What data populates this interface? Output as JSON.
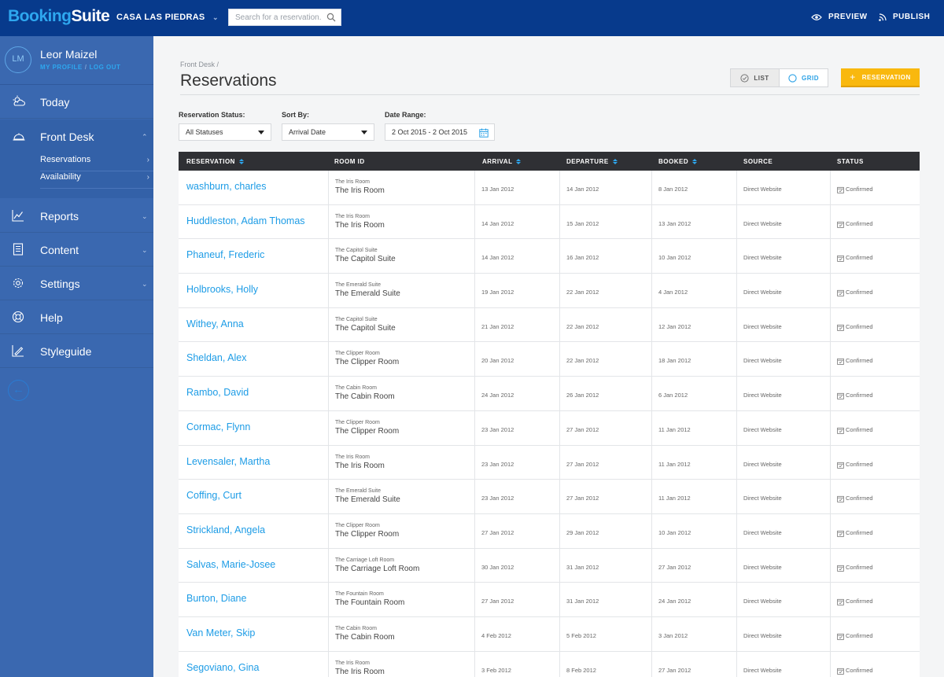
{
  "app": {
    "logo_part1": "Booking",
    "logo_part2": "Suite",
    "hotel": "CASA LAS PIEDRAS"
  },
  "search": {
    "placeholder": "Search for a reservation..."
  },
  "topbar": {
    "preview": "PREVIEW",
    "publish": "PUBLISH"
  },
  "user": {
    "initials": "LM",
    "name": "Leor Maizel",
    "my_profile": "MY PROFILE",
    "separator": "/",
    "log_out": "LOG OUT"
  },
  "nav": {
    "today": "Today",
    "front_desk": "Front Desk",
    "sub": [
      "Reservations",
      "Availability"
    ],
    "reports": "Reports",
    "content": "Content",
    "settings": "Settings",
    "help": "Help",
    "styleguide": "Styleguide"
  },
  "page": {
    "breadcrumb": "Front Desk /",
    "title": "Reservations",
    "view_list": "LIST",
    "view_grid": "GRID",
    "add_button": "RESERVATION"
  },
  "filters": {
    "status_label": "Reservation Status:",
    "status_value": "All Statuses",
    "sort_label": "Sort By:",
    "sort_value": "Arrival Date",
    "date_label": "Date Range:",
    "date_value": "2 Oct 2015 - 2 Oct 2015"
  },
  "table": {
    "headers": [
      "RESERVATION",
      "ROOM ID",
      "ARRIVAL",
      "DEPARTURE",
      "BOOKED",
      "SOURCE",
      "STATUS"
    ],
    "rows": [
      {
        "name": "washburn, charles",
        "room_small": "The Iris Room",
        "room": "The Iris Room",
        "arrival": "13 Jan 2012",
        "departure": "14 Jan 2012",
        "booked": "8 Jan 2012",
        "source": "Direct Website",
        "status": "Confirmed"
      },
      {
        "name": "Huddleston, Adam Thomas",
        "room_small": "The Iris Room",
        "room": "The Iris Room",
        "arrival": "14 Jan 2012",
        "departure": "15 Jan 2012",
        "booked": "13 Jan 2012",
        "source": "Direct Website",
        "status": "Confirmed"
      },
      {
        "name": "Phaneuf, Frederic",
        "room_small": "The Capitol Suite",
        "room": "The Capitol Suite",
        "arrival": "14 Jan 2012",
        "departure": "16 Jan 2012",
        "booked": "10 Jan 2012",
        "source": "Direct Website",
        "status": "Confirmed"
      },
      {
        "name": "Holbrooks, Holly",
        "room_small": "The Emerald Suite",
        "room": "The Emerald Suite",
        "arrival": "19 Jan 2012",
        "departure": "22 Jan 2012",
        "booked": "4 Jan 2012",
        "source": "Direct Website",
        "status": "Confirmed"
      },
      {
        "name": "Withey, Anna",
        "room_small": "The Capitol Suite",
        "room": "The Capitol Suite",
        "arrival": "21 Jan 2012",
        "departure": "22 Jan 2012",
        "booked": "12 Jan 2012",
        "source": "Direct Website",
        "status": "Confirmed"
      },
      {
        "name": "Sheldan, Alex",
        "room_small": "The Clipper Room",
        "room": "The Clipper Room",
        "arrival": "20 Jan 2012",
        "departure": "22 Jan 2012",
        "booked": "18 Jan 2012",
        "source": "Direct Website",
        "status": "Confirmed"
      },
      {
        "name": "Rambo, David",
        "room_small": "The Cabin Room",
        "room": "The Cabin Room",
        "arrival": "24 Jan 2012",
        "departure": "26 Jan 2012",
        "booked": "6 Jan 2012",
        "source": "Direct Website",
        "status": "Confirmed"
      },
      {
        "name": "Cormac, Flynn",
        "room_small": "The Clipper Room",
        "room": "The Clipper Room",
        "arrival": "23 Jan 2012",
        "departure": "27 Jan 2012",
        "booked": "11 Jan 2012",
        "source": "Direct Website",
        "status": "Confirmed"
      },
      {
        "name": "Levensaler, Martha",
        "room_small": "The Iris Room",
        "room": "The Iris Room",
        "arrival": "23 Jan 2012",
        "departure": "27 Jan 2012",
        "booked": "11 Jan 2012",
        "source": "Direct Website",
        "status": "Confirmed"
      },
      {
        "name": "Coffing, Curt",
        "room_small": "The Emerald Suite",
        "room": "The Emerald Suite",
        "arrival": "23 Jan 2012",
        "departure": "27 Jan 2012",
        "booked": "11 Jan 2012",
        "source": "Direct Website",
        "status": "Confirmed"
      },
      {
        "name": "Strickland, Angela",
        "room_small": "The Clipper Room",
        "room": "The Clipper Room",
        "arrival": "27 Jan 2012",
        "departure": "29 Jan 2012",
        "booked": "10 Jan 2012",
        "source": "Direct Website",
        "status": "Confirmed"
      },
      {
        "name": "Salvas, Marie-Josee",
        "room_small": "The Carriage Loft Room",
        "room": "The Carriage Loft Room",
        "arrival": "30 Jan 2012",
        "departure": "31 Jan 2012",
        "booked": "27 Jan 2012",
        "source": "Direct Website",
        "status": "Confirmed"
      },
      {
        "name": "Burton, Diane",
        "room_small": "The Fountain Room",
        "room": "The Fountain Room",
        "arrival": "27 Jan 2012",
        "departure": "31 Jan 2012",
        "booked": "24 Jan 2012",
        "source": "Direct Website",
        "status": "Confirmed"
      },
      {
        "name": "Van Meter, Skip",
        "room_small": "The Cabin Room",
        "room": "The Cabin Room",
        "arrival": "4 Feb 2012",
        "departure": "5 Feb 2012",
        "booked": "3 Jan 2012",
        "source": "Direct Website",
        "status": "Confirmed"
      },
      {
        "name": "Segoviano, Gina",
        "room_small": "The Iris Room",
        "room": "The Iris Room",
        "arrival": "3 Feb 2012",
        "departure": "8 Feb 2012",
        "booked": "27 Jan 2012",
        "source": "Direct Website",
        "status": "Confirmed"
      }
    ]
  },
  "colors": {
    "topbar": "#073a8c",
    "sidebar": "#3a68b0",
    "accent": "#1d9ce6",
    "button": "#f9b80e",
    "table_header": "#2f3034"
  }
}
